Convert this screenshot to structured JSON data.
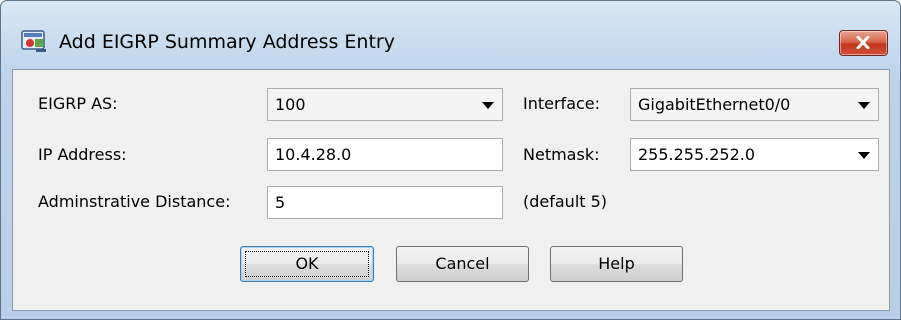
{
  "window": {
    "title": "Add EIGRP Summary Address Entry"
  },
  "form": {
    "eigrp_as": {
      "label": "EIGRP AS:",
      "value": "100"
    },
    "interface": {
      "label": "Interface:",
      "value": "GigabitEthernet0/0"
    },
    "ip_address": {
      "label": "IP Address:",
      "value": "10.4.28.0"
    },
    "netmask": {
      "label": "Netmask:",
      "value": "255.255.252.0"
    },
    "admin_distance": {
      "label": "Adminstrative Distance:",
      "value": "5",
      "hint": "(default 5)"
    }
  },
  "buttons": {
    "ok": "OK",
    "cancel": "Cancel",
    "help": "Help"
  },
  "colors": {
    "titlebar": "#c9ddf0",
    "client": "#f0f0f0",
    "close": "#c3361d",
    "default_button_border": "#3c7fb1"
  },
  "icons": {
    "app": "asdm-app-icon",
    "close": "close-icon",
    "dropdown": "chevron-down-icon"
  }
}
